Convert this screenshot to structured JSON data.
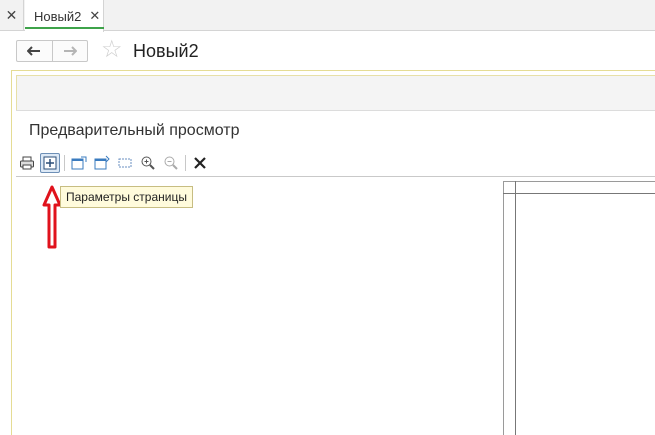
{
  "tabs": {
    "close_all_icon": "close-icon",
    "active_tab": {
      "label": "Новый2",
      "close_icon": "close-icon",
      "accent": "#3ea34a"
    }
  },
  "document": {
    "title": "Новый2",
    "back_icon": "arrow-left-icon",
    "forward_icon": "arrow-right-icon",
    "favorite_icon": "star-icon"
  },
  "preview": {
    "title": "Предварительный просмотр",
    "toolbar": [
      {
        "icon": "print-icon",
        "active": false
      },
      {
        "icon": "page-settings-icon",
        "active": true
      },
      {
        "icon": "export-icon",
        "active": false
      },
      {
        "icon": "export-alt-icon",
        "active": false
      },
      {
        "icon": "select-area-icon",
        "active": false
      },
      {
        "icon": "zoom-in-icon",
        "active": false
      },
      {
        "icon": "zoom-out-icon",
        "active": false
      },
      {
        "icon": "close-icon",
        "active": false
      }
    ],
    "tooltip": "Параметры страницы"
  },
  "annotation": {
    "arrow_color": "#e0121c"
  }
}
